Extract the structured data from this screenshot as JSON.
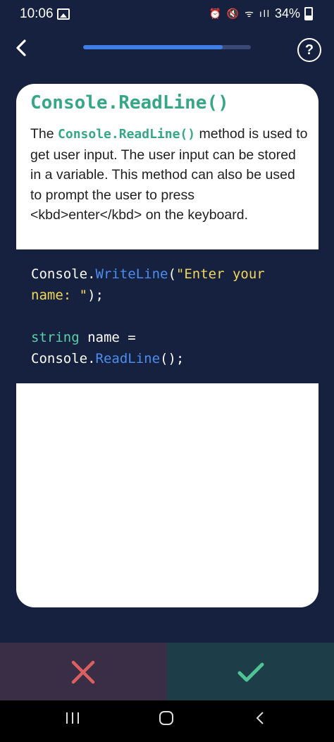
{
  "status_bar": {
    "time": "10:06",
    "battery": "34%",
    "icons": [
      "gallery-icon",
      "alarm-icon",
      "mute-icon",
      "wifi-icon",
      "signal-icon",
      "battery-icon"
    ]
  },
  "header": {
    "progress": 0.83,
    "progress_color": "#3f7ee6",
    "back_icon": "chevron-left-icon",
    "help_label": "?"
  },
  "card": {
    "title": "Console.ReadLine()",
    "body_prefix": "The ",
    "body_code": "Console.ReadLine()",
    "body_suffix": " method is used to get user input. The user input can be stored in a variable. This method can also be used to prompt the user to press <kbd>enter</kbd> on the keyboard.",
    "code": {
      "line1": [
        "Console.",
        "WriteLine",
        "(",
        "\"Enter your"
      ],
      "line2": [
        "name: \"",
        ");"
      ],
      "line3": [
        "string",
        " name ="
      ],
      "line4": [
        "Console.",
        "ReadLine",
        "();"
      ]
    }
  },
  "answers": {
    "wrong_icon": "close-icon",
    "right_icon": "check-icon",
    "wrong_color": "#d9605e",
    "right_color": "#4fc393"
  },
  "system_nav": {
    "icons": [
      "recent-apps-icon",
      "home-icon",
      "back-icon"
    ]
  }
}
